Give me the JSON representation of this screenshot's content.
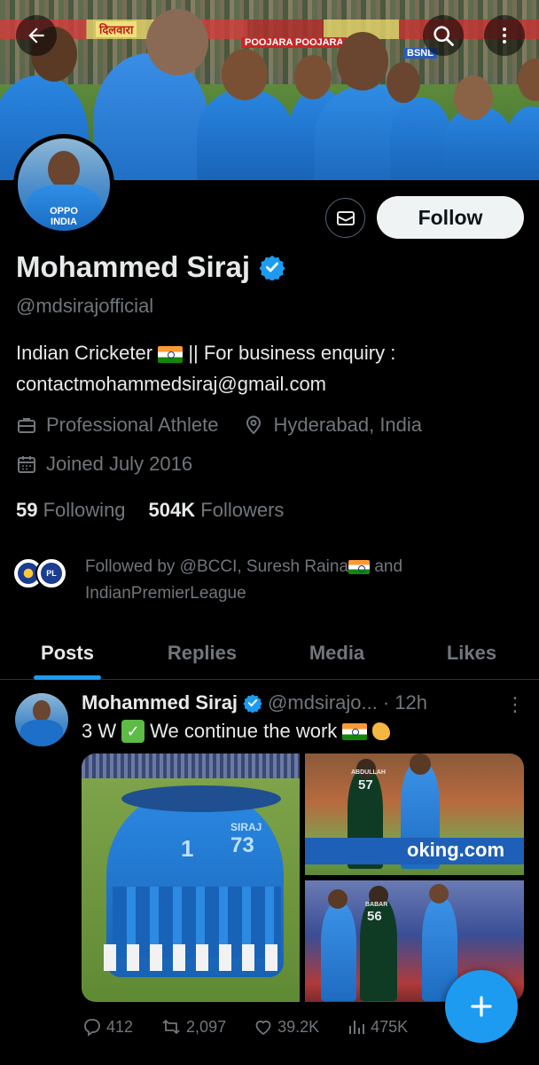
{
  "profile": {
    "name": "Mohammed Siraj",
    "handle": "@mdsirajofficial",
    "bio_line1": "Indian Cricketer",
    "bio_line1_suffix": "|| For business enquiry :",
    "bio_line2": "contactmohammedsiraj@gmail.com",
    "category": "Professional Athlete",
    "location": "Hyderabad, India",
    "joined": "Joined July 2016",
    "following_count": "59",
    "following_label": "Following",
    "followers_count": "504K",
    "followers_label": "Followers",
    "followed_by_prefix": "Followed by @BCCI, Suresh Raina",
    "followed_by_suffix": "and",
    "followed_by_line2": "IndianPremierLeague",
    "follow_button": "Follow",
    "avatar_text": "OPPO INDIA"
  },
  "banner": {
    "ad_texts": [
      "दिलवारा",
      "POOJARA POOJARA",
      "BSNL"
    ]
  },
  "tabs": [
    {
      "label": "Posts",
      "active": true
    },
    {
      "label": "Replies",
      "active": false
    },
    {
      "label": "Media",
      "active": false
    },
    {
      "label": "Likes",
      "active": false
    }
  ],
  "post": {
    "author": "Mohammed Siraj",
    "handle": "@mdsirajo...",
    "time": "· 12h",
    "text_prefix": "3 W",
    "text_middle": "We continue the work",
    "jersey_numbers": [
      "1",
      "73",
      "57",
      "56"
    ],
    "jersey_names": [
      "SIRAJ",
      "ABDULLAH",
      "BABAR"
    ],
    "ad_text": "oking.com",
    "replies": "412",
    "reposts": "2,097",
    "likes": "39.2K",
    "views": "475K"
  },
  "colors": {
    "accent": "#1d9bf0",
    "background": "#000000",
    "muted": "#71767b",
    "text": "#e7e9ea"
  },
  "icons": [
    "back-arrow-icon",
    "search-icon",
    "more-vertical-icon",
    "verified-badge-icon",
    "mail-icon",
    "briefcase-icon",
    "location-pin-icon",
    "calendar-icon",
    "reply-icon",
    "repost-icon",
    "like-icon",
    "views-icon",
    "plus-icon"
  ]
}
